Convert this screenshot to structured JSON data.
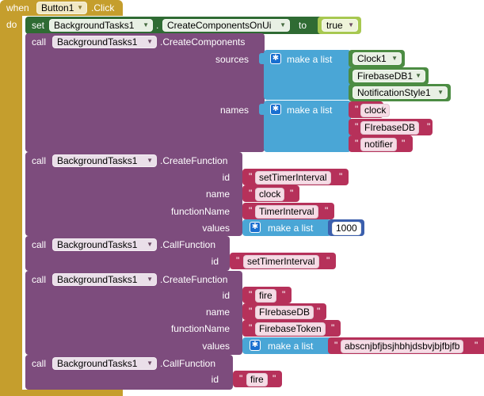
{
  "event": {
    "when": "when",
    "component": "Button1",
    "event": ".Click",
    "do": "do"
  },
  "set_block": {
    "set": "set",
    "component": "BackgroundTasks1",
    "dot": ".",
    "property": "CreateComponentsOnUi",
    "to": "to",
    "value": "true"
  },
  "call1": {
    "call": "call",
    "component": "BackgroundTasks1",
    "method": ".CreateComponents",
    "sources_label": "sources",
    "names_label": "names",
    "make_list": "make a list",
    "sources": [
      "Clock1",
      "FirebaseDB1",
      "NotificationStyle1"
    ],
    "names": [
      "clock",
      "FIrebaseDB",
      "notifier"
    ]
  },
  "call2": {
    "call": "call",
    "component": "BackgroundTasks1",
    "method": ".CreateFunction",
    "labels": {
      "id": "id",
      "name": "name",
      "functionName": "functionName",
      "values": "values"
    },
    "id": "setTimerInterval",
    "name": "clock",
    "functionName": "TimerInterval",
    "make_list": "make a list",
    "value_number": "1000"
  },
  "call3": {
    "call": "call",
    "component": "BackgroundTasks1",
    "method": ".CallFunction",
    "id_label": "id",
    "id": "setTimerInterval"
  },
  "call4": {
    "call": "call",
    "component": "BackgroundTasks1",
    "method": ".CreateFunction",
    "labels": {
      "id": "id",
      "name": "name",
      "functionName": "functionName",
      "values": "values"
    },
    "id": "fire",
    "name": "FIrebaseDB",
    "functionName": "FirebaseToken",
    "make_list": "make a list",
    "value_text": "abscnjbfjbsjhbhjdsbvjbjfbjfb"
  },
  "call5": {
    "call": "call",
    "component": "BackgroundTasks1",
    "method": ".CallFunction",
    "id_label": "id",
    "id": "fire"
  },
  "quote": "\"",
  "colors": {
    "event": "#c59e2d",
    "procedure": "#7d4c7d",
    "list": "#4aa6d6",
    "component": "#4c8c43",
    "text": "#b6315a",
    "logic": "#a7c850",
    "math": "#3b5fad"
  }
}
